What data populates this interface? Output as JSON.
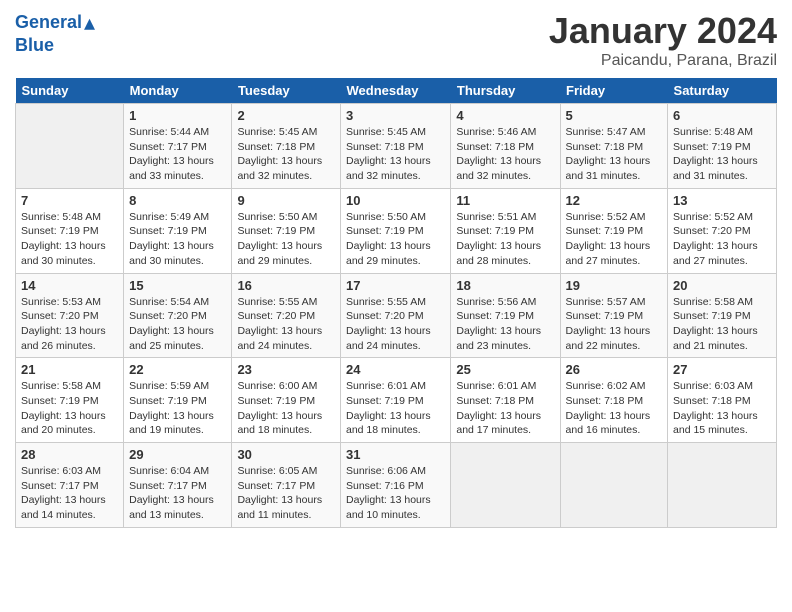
{
  "logo": {
    "line1": "General",
    "line2": "Blue"
  },
  "title": "January 2024",
  "subtitle": "Paicandu, Parana, Brazil",
  "days_of_week": [
    "Sunday",
    "Monday",
    "Tuesday",
    "Wednesday",
    "Thursday",
    "Friday",
    "Saturday"
  ],
  "weeks": [
    [
      {
        "day": "",
        "sunrise": "",
        "sunset": "",
        "daylight": ""
      },
      {
        "day": "1",
        "sunrise": "Sunrise: 5:44 AM",
        "sunset": "Sunset: 7:17 PM",
        "daylight": "Daylight: 13 hours and 33 minutes."
      },
      {
        "day": "2",
        "sunrise": "Sunrise: 5:45 AM",
        "sunset": "Sunset: 7:18 PM",
        "daylight": "Daylight: 13 hours and 32 minutes."
      },
      {
        "day": "3",
        "sunrise": "Sunrise: 5:45 AM",
        "sunset": "Sunset: 7:18 PM",
        "daylight": "Daylight: 13 hours and 32 minutes."
      },
      {
        "day": "4",
        "sunrise": "Sunrise: 5:46 AM",
        "sunset": "Sunset: 7:18 PM",
        "daylight": "Daylight: 13 hours and 32 minutes."
      },
      {
        "day": "5",
        "sunrise": "Sunrise: 5:47 AM",
        "sunset": "Sunset: 7:18 PM",
        "daylight": "Daylight: 13 hours and 31 minutes."
      },
      {
        "day": "6",
        "sunrise": "Sunrise: 5:48 AM",
        "sunset": "Sunset: 7:19 PM",
        "daylight": "Daylight: 13 hours and 31 minutes."
      }
    ],
    [
      {
        "day": "7",
        "sunrise": "Sunrise: 5:48 AM",
        "sunset": "Sunset: 7:19 PM",
        "daylight": "Daylight: 13 hours and 30 minutes."
      },
      {
        "day": "8",
        "sunrise": "Sunrise: 5:49 AM",
        "sunset": "Sunset: 7:19 PM",
        "daylight": "Daylight: 13 hours and 30 minutes."
      },
      {
        "day": "9",
        "sunrise": "Sunrise: 5:50 AM",
        "sunset": "Sunset: 7:19 PM",
        "daylight": "Daylight: 13 hours and 29 minutes."
      },
      {
        "day": "10",
        "sunrise": "Sunrise: 5:50 AM",
        "sunset": "Sunset: 7:19 PM",
        "daylight": "Daylight: 13 hours and 29 minutes."
      },
      {
        "day": "11",
        "sunrise": "Sunrise: 5:51 AM",
        "sunset": "Sunset: 7:19 PM",
        "daylight": "Daylight: 13 hours and 28 minutes."
      },
      {
        "day": "12",
        "sunrise": "Sunrise: 5:52 AM",
        "sunset": "Sunset: 7:19 PM",
        "daylight": "Daylight: 13 hours and 27 minutes."
      },
      {
        "day": "13",
        "sunrise": "Sunrise: 5:52 AM",
        "sunset": "Sunset: 7:20 PM",
        "daylight": "Daylight: 13 hours and 27 minutes."
      }
    ],
    [
      {
        "day": "14",
        "sunrise": "Sunrise: 5:53 AM",
        "sunset": "Sunset: 7:20 PM",
        "daylight": "Daylight: 13 hours and 26 minutes."
      },
      {
        "day": "15",
        "sunrise": "Sunrise: 5:54 AM",
        "sunset": "Sunset: 7:20 PM",
        "daylight": "Daylight: 13 hours and 25 minutes."
      },
      {
        "day": "16",
        "sunrise": "Sunrise: 5:55 AM",
        "sunset": "Sunset: 7:20 PM",
        "daylight": "Daylight: 13 hours and 24 minutes."
      },
      {
        "day": "17",
        "sunrise": "Sunrise: 5:55 AM",
        "sunset": "Sunset: 7:20 PM",
        "daylight": "Daylight: 13 hours and 24 minutes."
      },
      {
        "day": "18",
        "sunrise": "Sunrise: 5:56 AM",
        "sunset": "Sunset: 7:19 PM",
        "daylight": "Daylight: 13 hours and 23 minutes."
      },
      {
        "day": "19",
        "sunrise": "Sunrise: 5:57 AM",
        "sunset": "Sunset: 7:19 PM",
        "daylight": "Daylight: 13 hours and 22 minutes."
      },
      {
        "day": "20",
        "sunrise": "Sunrise: 5:58 AM",
        "sunset": "Sunset: 7:19 PM",
        "daylight": "Daylight: 13 hours and 21 minutes."
      }
    ],
    [
      {
        "day": "21",
        "sunrise": "Sunrise: 5:58 AM",
        "sunset": "Sunset: 7:19 PM",
        "daylight": "Daylight: 13 hours and 20 minutes."
      },
      {
        "day": "22",
        "sunrise": "Sunrise: 5:59 AM",
        "sunset": "Sunset: 7:19 PM",
        "daylight": "Daylight: 13 hours and 19 minutes."
      },
      {
        "day": "23",
        "sunrise": "Sunrise: 6:00 AM",
        "sunset": "Sunset: 7:19 PM",
        "daylight": "Daylight: 13 hours and 18 minutes."
      },
      {
        "day": "24",
        "sunrise": "Sunrise: 6:01 AM",
        "sunset": "Sunset: 7:19 PM",
        "daylight": "Daylight: 13 hours and 18 minutes."
      },
      {
        "day": "25",
        "sunrise": "Sunrise: 6:01 AM",
        "sunset": "Sunset: 7:18 PM",
        "daylight": "Daylight: 13 hours and 17 minutes."
      },
      {
        "day": "26",
        "sunrise": "Sunrise: 6:02 AM",
        "sunset": "Sunset: 7:18 PM",
        "daylight": "Daylight: 13 hours and 16 minutes."
      },
      {
        "day": "27",
        "sunrise": "Sunrise: 6:03 AM",
        "sunset": "Sunset: 7:18 PM",
        "daylight": "Daylight: 13 hours and 15 minutes."
      }
    ],
    [
      {
        "day": "28",
        "sunrise": "Sunrise: 6:03 AM",
        "sunset": "Sunset: 7:17 PM",
        "daylight": "Daylight: 13 hours and 14 minutes."
      },
      {
        "day": "29",
        "sunrise": "Sunrise: 6:04 AM",
        "sunset": "Sunset: 7:17 PM",
        "daylight": "Daylight: 13 hours and 13 minutes."
      },
      {
        "day": "30",
        "sunrise": "Sunrise: 6:05 AM",
        "sunset": "Sunset: 7:17 PM",
        "daylight": "Daylight: 13 hours and 11 minutes."
      },
      {
        "day": "31",
        "sunrise": "Sunrise: 6:06 AM",
        "sunset": "Sunset: 7:16 PM",
        "daylight": "Daylight: 13 hours and 10 minutes."
      },
      {
        "day": "",
        "sunrise": "",
        "sunset": "",
        "daylight": ""
      },
      {
        "day": "",
        "sunrise": "",
        "sunset": "",
        "daylight": ""
      },
      {
        "day": "",
        "sunrise": "",
        "sunset": "",
        "daylight": ""
      }
    ]
  ]
}
